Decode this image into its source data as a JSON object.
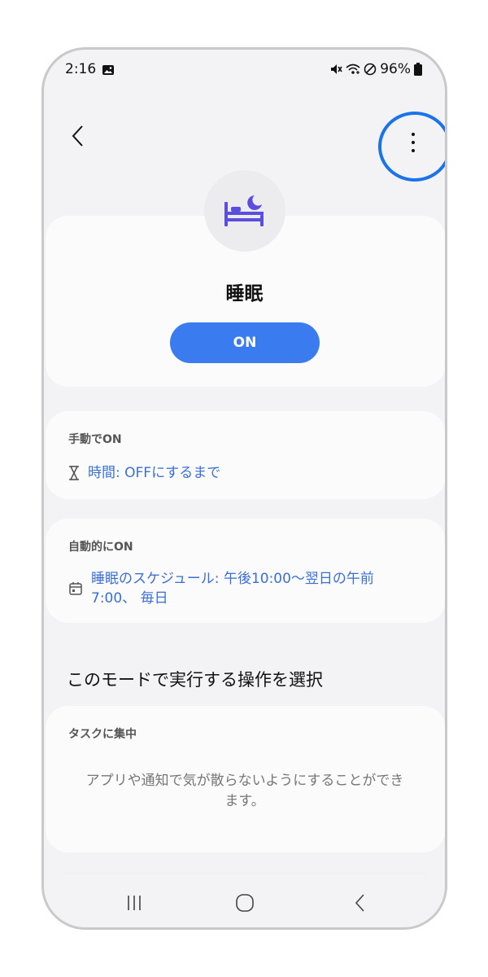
{
  "status_bar": {
    "time": "2:16",
    "battery": "96%"
  },
  "mode": {
    "title": "睡眠",
    "toggle_label": "ON",
    "icon": "bed-moon-icon"
  },
  "manual": {
    "header": "手動でON",
    "link": "時間: OFFにするまで",
    "icon": "hourglass-icon"
  },
  "auto": {
    "header": "自動的にON",
    "link_line1": "睡眠のスケジュール: 午後10:00〜翌日の午前",
    "link_line2": "7:00、 毎日",
    "icon": "calendar-icon"
  },
  "actions_section": {
    "title": "このモードで実行する操作を選択"
  },
  "task_card": {
    "header": "タスクに集中",
    "desc_line1": "アプリや通知で気が散らないようにすることができ",
    "desc_line2": "ます。"
  },
  "colors": {
    "accent": "#3a7cf0",
    "link": "#3a6fd8",
    "icon_purple": "#5b4de0",
    "highlight": "#1a73e8"
  }
}
